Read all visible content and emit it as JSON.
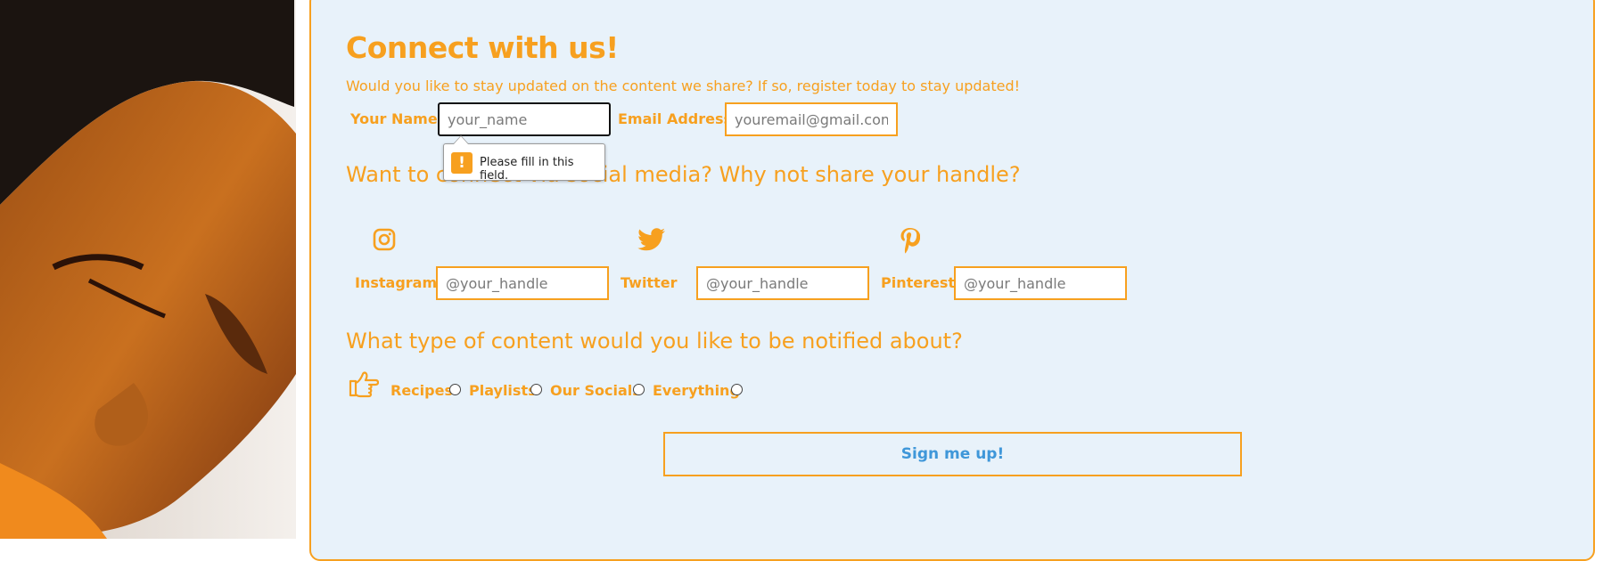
{
  "form": {
    "title": "Connect with us!",
    "subtitle": "Would you like to stay updated on the content we share? If so, register today to stay updated!",
    "name_label": "Your Name:",
    "name_placeholder": "your_name",
    "email_label": "Email Address:",
    "email_placeholder": "youremail@gmail.com",
    "validation_message": "Please fill in this field."
  },
  "social": {
    "heading": "Want to connect via social media? Why not share your handle?",
    "items": [
      {
        "label": "Instagram",
        "icon": "instagram-icon",
        "placeholder": "@your_handle"
      },
      {
        "label": "Twitter",
        "icon": "twitter-icon",
        "placeholder": "@your_handle"
      },
      {
        "label": "Pinterest",
        "icon": "pinterest-icon",
        "placeholder": "@your_handle"
      }
    ]
  },
  "notify": {
    "heading": "What type of content would you like to be notified about?",
    "icon": "pointing-hand-icon",
    "options": [
      "Recipes",
      "Playlists",
      "Our Socials",
      "Everything"
    ]
  },
  "submit_label": "Sign me up!",
  "colors": {
    "accent": "#f7a01f",
    "panel_bg": "#e8f2fa",
    "button_text": "#3f97d9"
  }
}
